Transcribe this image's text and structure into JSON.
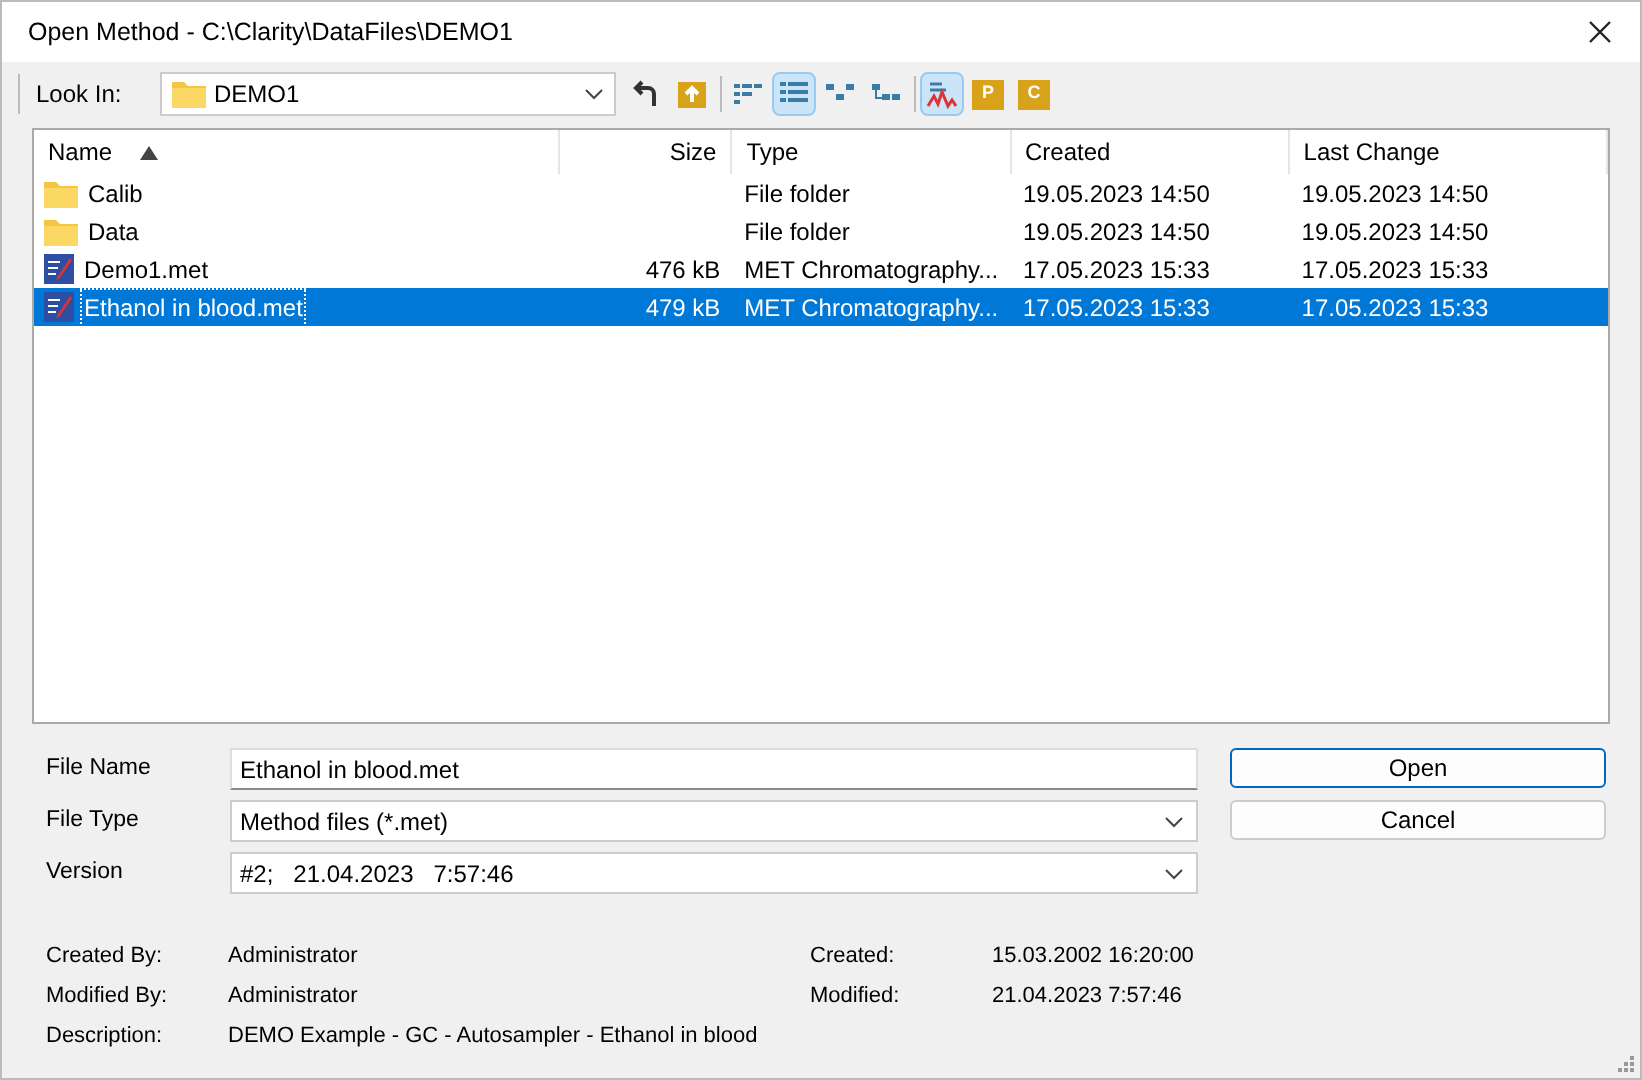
{
  "window": {
    "title": "Open Method - C:\\Clarity\\DataFiles\\DEMO1"
  },
  "look_in": {
    "label": "Look In:",
    "value": "DEMO1"
  },
  "toolbar": [
    {
      "kind": "back",
      "selected": false
    },
    {
      "kind": "up",
      "selected": false
    },
    {
      "kind": "list",
      "selected": false
    },
    {
      "kind": "details",
      "selected": true
    },
    {
      "kind": "tree",
      "selected": false
    },
    {
      "kind": "tree2",
      "selected": false
    },
    {
      "kind": "chart",
      "selected": true
    },
    {
      "kind": "p",
      "selected": false,
      "text": "P"
    },
    {
      "kind": "c",
      "selected": false,
      "text": "C"
    }
  ],
  "table": {
    "columns": [
      {
        "label": "Name",
        "sorted": true
      },
      {
        "label": "Size",
        "sorted": false
      },
      {
        "label": "Type",
        "sorted": false
      },
      {
        "label": "Created",
        "sorted": false
      },
      {
        "label": "Last Change",
        "sorted": false
      }
    ],
    "rows": [
      {
        "kind": "folder",
        "name": "Calib",
        "size": "",
        "type": "File folder",
        "created": "19.05.2023 14:50",
        "changed": "19.05.2023 14:50",
        "selected": false
      },
      {
        "kind": "folder",
        "name": "Data",
        "size": "",
        "type": "File folder",
        "created": "19.05.2023 14:50",
        "changed": "19.05.2023 14:50",
        "selected": false
      },
      {
        "kind": "method",
        "name": "Demo1.met",
        "size": "476 kB",
        "type": "MET Chromatography...",
        "created": "17.05.2023 15:33",
        "changed": "17.05.2023 15:33",
        "selected": false
      },
      {
        "kind": "method",
        "name": "Ethanol in blood.met",
        "size": "479 kB",
        "type": "MET Chromatography...",
        "created": "17.05.2023 15:33",
        "changed": "17.05.2023 15:33",
        "selected": true
      }
    ]
  },
  "form": [
    {
      "kind": "text",
      "label": "File Name",
      "value": "Ethanol in blood.met"
    },
    {
      "kind": "select",
      "label": "File Type",
      "value": "Method files (*.met)"
    },
    {
      "kind": "select",
      "label": "Version",
      "value": "#2;   21.04.2023   7:57:46"
    }
  ],
  "buttons": [
    {
      "label": "Open",
      "default": true
    },
    {
      "label": "Cancel",
      "default": false
    }
  ],
  "info_left": [
    {
      "label": "Created By:",
      "value": "Administrator"
    },
    {
      "label": "Modified By:",
      "value": "Administrator"
    },
    {
      "label": "Description:",
      "value": "DEMO Example - GC - Autosampler - Ethanol in blood"
    }
  ],
  "info_right": [
    {
      "label": "Created:",
      "value": "15.03.2002 16:20:00"
    },
    {
      "label": "Modified:",
      "value": "21.04.2023 7:57:46"
    }
  ]
}
